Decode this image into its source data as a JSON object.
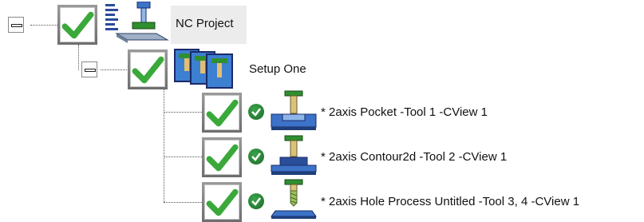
{
  "tree": {
    "project": {
      "label": "NC Project",
      "icon": "nc-project-icon"
    },
    "setup": {
      "label": "Setup One",
      "icon": "setup-stack-icon"
    },
    "operations": [
      {
        "label": "* 2axis Pocket  -Tool 1 -CView 1",
        "icon": "pocket-tool-icon"
      },
      {
        "label": "* 2axis Contour2d  -Tool 2 -CView 1",
        "icon": "contour-tool-icon"
      },
      {
        "label": "* 2axis Hole Process Untitled -Tool 3, 4 -CView 1",
        "icon": "drill-tool-icon"
      }
    ]
  },
  "colors": {
    "check_green": "#3aa93a",
    "tool_blue": "#3c73c8",
    "tool_green": "#2f8f2f",
    "status_green": "#2b8a37"
  }
}
